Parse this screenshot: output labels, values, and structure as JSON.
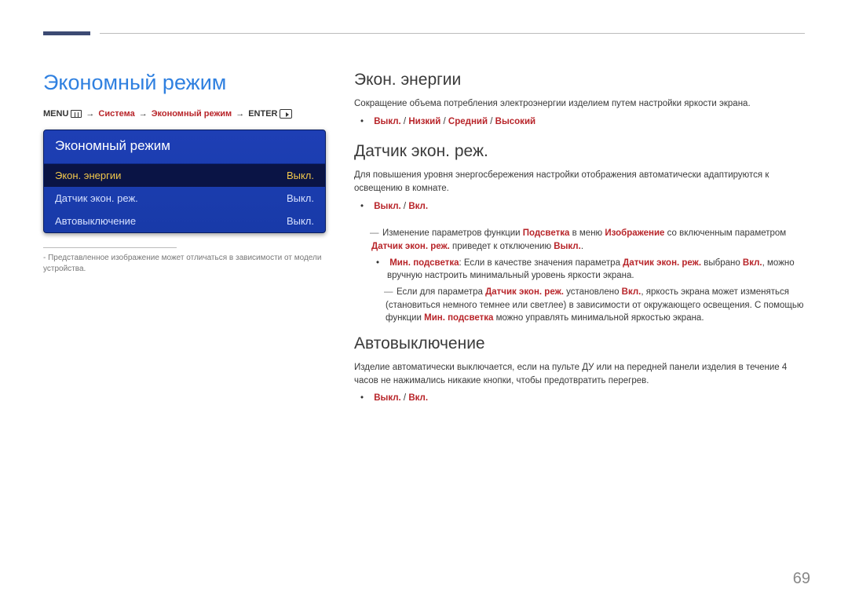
{
  "page_number": "69",
  "left": {
    "title": "Экономный режим",
    "breadcrumb": {
      "menu": "MENU",
      "step1": "Система",
      "step2": "Экономный режим",
      "enter": "ENTER"
    },
    "menu": {
      "header": "Экономный режим",
      "rows": [
        {
          "label": "Экон. энергии",
          "value": "Выкл.",
          "active": true
        },
        {
          "label": "Датчик экон. реж.",
          "value": "Выкл.",
          "active": false
        },
        {
          "label": "Автовыключение",
          "value": "Выкл.",
          "active": false
        }
      ]
    },
    "footnote": "Представленное изображение может отличаться в зависимости от модели устройства."
  },
  "right": {
    "s1": {
      "title": "Экон. энергии",
      "desc": "Сокращение объема потребления электроэнергии изделием путем настройки яркости экрана.",
      "options_parts": [
        "Выкл.",
        " / ",
        "Низкий",
        " / ",
        "Средний",
        " / ",
        "Высокий"
      ]
    },
    "s2": {
      "title": "Датчик экон. реж.",
      "desc": "Для повышения уровня энергосбережения настройки отображения автоматически адаптируются к освещению в комнате.",
      "options_parts": [
        "Выкл.",
        " / ",
        "Вкл."
      ],
      "note1_pre": "Изменение параметров функции ",
      "note1_b1": "Подсветка",
      "note1_mid1": " в меню ",
      "note1_b2": "Изображение",
      "note1_mid2": " со включенным параметром ",
      "note1_b3": "Датчик экон. реж.",
      "note1_end": " приведет к отключению ",
      "note1_b4": "Выкл.",
      "sub1_b1": "Мин. подсветка",
      "sub1_t1": ": Если в качестве значения параметра ",
      "sub1_b2": "Датчик экон. реж.",
      "sub1_t2": " выбрано ",
      "sub1_b3": "Вкл.",
      "sub1_t3": ", можно вручную настроить минимальный уровень яркости экрана.",
      "note2_t1": "Если для параметра ",
      "note2_b1": "Датчик экон. реж.",
      "note2_t2": " установлено ",
      "note2_b2": "Вкл.",
      "note2_t3": ", яркость экрана может изменяться (становиться немного темнее или светлее) в зависимости от окружающего освещения. С помощью функции ",
      "note2_b3": "Мин. подсветка",
      "note2_t4": " можно управлять минимальной яркостью экрана."
    },
    "s3": {
      "title": "Автовыключение",
      "desc": "Изделие автоматически выключается, если на пульте ДУ или на передней панели изделия в течение 4 часов не нажимались никакие кнопки, чтобы предотвратить перегрев.",
      "options_parts": [
        "Выкл.",
        " / ",
        "Вкл."
      ]
    }
  }
}
